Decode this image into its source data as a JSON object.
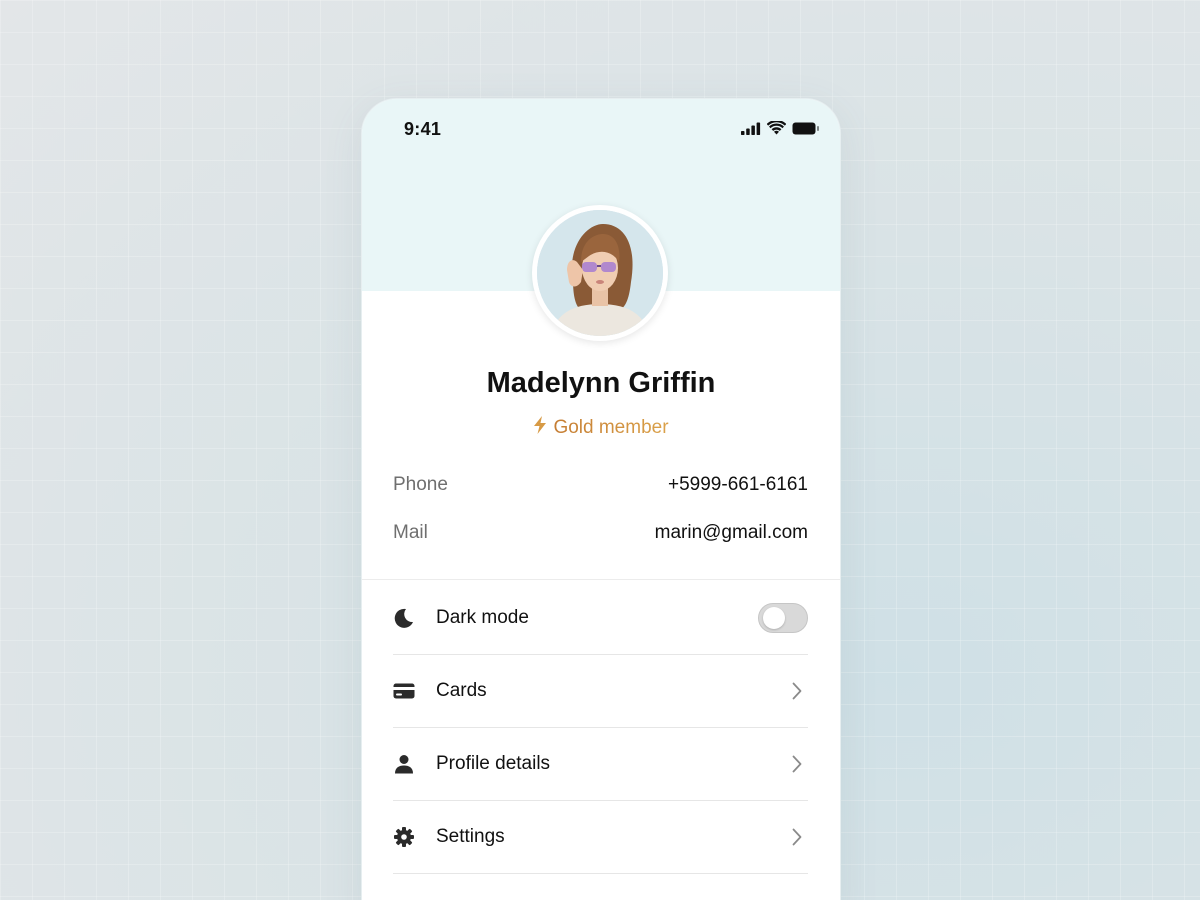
{
  "status_bar": {
    "time": "9:41"
  },
  "profile": {
    "name": "Madelynn Griffin",
    "membership": "Gold member"
  },
  "contact": [
    {
      "label": "Phone",
      "value": "+5999-661-6161"
    },
    {
      "label": "Mail",
      "value": "marin@gmail.com"
    }
  ],
  "menu": {
    "dark_mode": {
      "label": "Dark mode",
      "icon": "moon-icon",
      "enabled": false
    },
    "items": [
      {
        "label": "Cards",
        "icon": "card-icon"
      },
      {
        "label": "Profile details",
        "icon": "user-icon"
      },
      {
        "label": "Settings",
        "icon": "gear-icon"
      }
    ]
  },
  "colors": {
    "header_band": "#e9f6f7",
    "accent_gold": "#c98a38",
    "text_primary": "#111111",
    "text_secondary": "#6f6f6f"
  }
}
